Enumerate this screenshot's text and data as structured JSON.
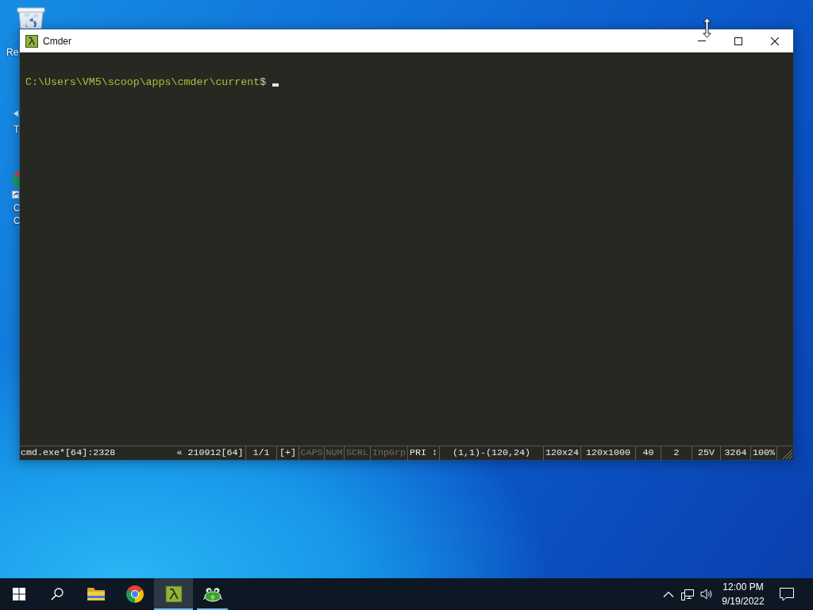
{
  "desktop": {
    "icons": [
      {
        "kind": "trash",
        "lines": [
          "Re"
        ]
      },
      {
        "kind": "arrow",
        "lines": [
          "T"
        ]
      },
      {
        "kind": "shortcut",
        "lines": [
          "C",
          "C"
        ]
      }
    ]
  },
  "window": {
    "title": "Cmder",
    "prompt": {
      "path": "C:\\Users\\VM5\\scoop\\apps\\cmder\\current",
      "symbol": "$"
    },
    "status_bar": [
      {
        "text": "cmd.exe*[64]:2328",
        "dimmed": false
      },
      {
        "text": "« 210912[64]",
        "dimmed": false
      },
      {
        "text": "1/1",
        "dimmed": false
      },
      {
        "text": "[+]",
        "dimmed": false
      },
      {
        "text": "CAPS",
        "dimmed": true
      },
      {
        "text": "NUM",
        "dimmed": true
      },
      {
        "text": "SCRL",
        "dimmed": true
      },
      {
        "text": "InpGrp",
        "dimmed": true
      },
      {
        "text": "PRI ↕",
        "dimmed": false
      },
      {
        "text": "(1,1)-(120,24)",
        "dimmed": false
      },
      {
        "text": "120x24",
        "dimmed": false
      },
      {
        "text": "120x1000",
        "dimmed": false
      },
      {
        "text": "40",
        "dimmed": false
      },
      {
        "text": "2",
        "dimmed": false
      },
      {
        "text": "25V",
        "dimmed": false
      },
      {
        "text": "3264",
        "dimmed": false
      },
      {
        "text": "100%",
        "dimmed": false
      }
    ]
  },
  "taskbar": {
    "apps": [
      {
        "kind": "folder",
        "running": false,
        "selected": false
      },
      {
        "kind": "browser",
        "running": false,
        "selected": false
      },
      {
        "kind": "lambda",
        "running": true,
        "selected": true
      },
      {
        "kind": "frog",
        "running": true,
        "selected": false
      }
    ],
    "clock": {
      "time": "12:00 PM",
      "date": "9/19/2022"
    }
  }
}
